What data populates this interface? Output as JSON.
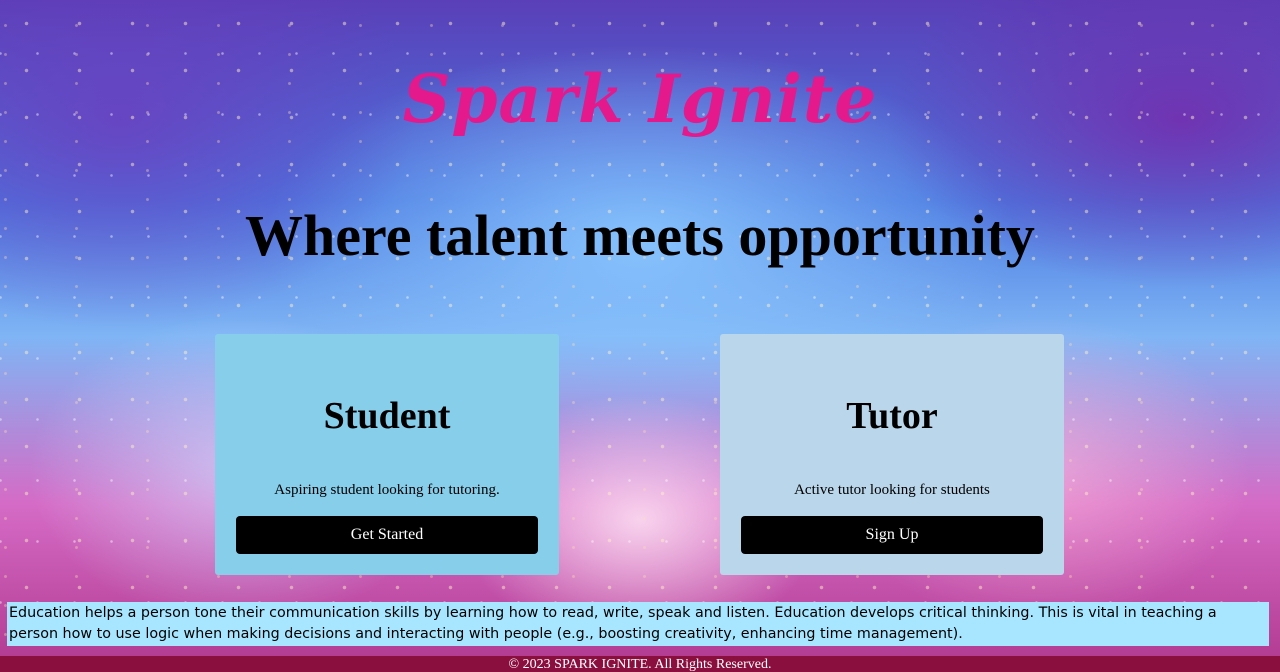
{
  "brand": {
    "name": "Spark Ignite",
    "color": "#e3198c"
  },
  "hero": {
    "tagline": "Where talent meets opportunity"
  },
  "cards": [
    {
      "title": "Student",
      "description": "Aspiring student looking for tutoring.",
      "button_label": "Get Started",
      "background": "#87ceeb"
    },
    {
      "title": "Tutor",
      "description": "Active tutor looking for students",
      "button_label": "Sign Up",
      "background": "#bad6ea"
    }
  ],
  "about": {
    "text": "Education helps a person tone their communication skills by learning how to read, write, speak and listen. Education develops critical thinking. This is vital in teaching a person how to use logic when making decisions and interacting with people (e.g., boosting creativity, enhancing time management)."
  },
  "footer": {
    "copyright": "© 2023 SPARK IGNITE. All Rights Reserved."
  }
}
